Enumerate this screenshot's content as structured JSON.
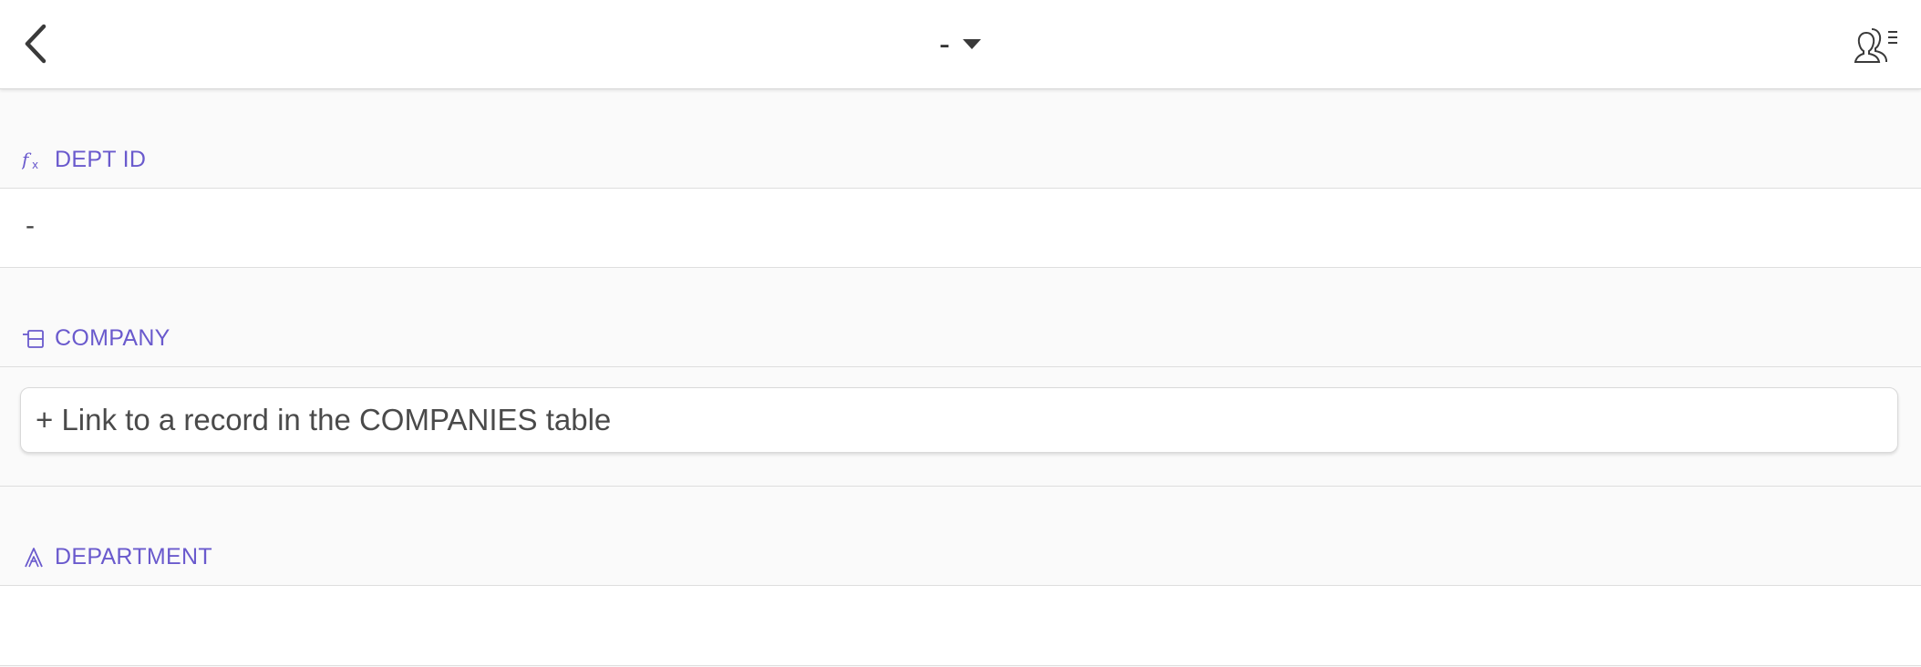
{
  "header": {
    "title": "-",
    "back_icon": "chevron-left-icon",
    "caret_icon": "caret-down-icon",
    "collaborators_icon": "collaborators-list-icon"
  },
  "fields": [
    {
      "label": "DEPT ID",
      "icon": "formula-icon",
      "value": "-"
    },
    {
      "label": "COMPANY",
      "icon": "linked-record-icon",
      "link_label": "+ Link to a record in the COMPANIES table"
    },
    {
      "label": "DEPARTMENT",
      "icon": "text-field-icon",
      "value": ""
    }
  ],
  "colors": {
    "accent": "#6a5acd",
    "text": "#444444",
    "background": "#fafafa"
  }
}
